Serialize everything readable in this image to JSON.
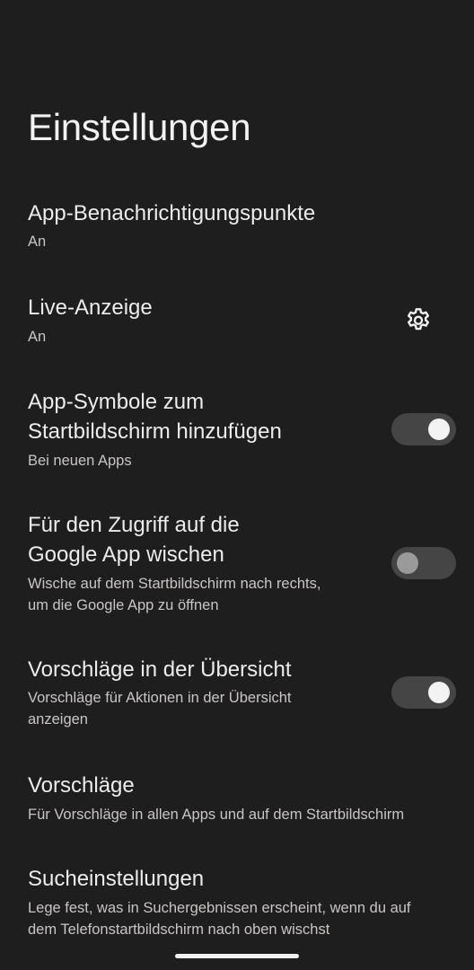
{
  "header": {
    "title": "Einstellungen"
  },
  "settings": [
    {
      "title": "App-Benachrichtigungspunkte",
      "subtitle": "An"
    },
    {
      "title": "Live-Anzeige",
      "subtitle": "An",
      "icon": "gear-icon"
    },
    {
      "title_line1": "App-Symbole zum",
      "title_line2": "Startbildschirm hinzufügen",
      "subtitle": "Bei neuen Apps",
      "toggle_on": true
    },
    {
      "title_line1": "Für den Zugriff auf die",
      "title_line2": "Google App wischen",
      "subtitle_line1": "Wische auf dem Startbildschirm nach rechts,",
      "subtitle_line2": "um die Google App zu öffnen",
      "toggle_on": false
    },
    {
      "title": "Vorschläge in der Übersicht",
      "subtitle_line1": "Vorschläge für Aktionen in der Übersicht",
      "subtitle_line2": "anzeigen",
      "toggle_on": true
    },
    {
      "title": "Vorschläge",
      "subtitle": "Für Vorschläge in allen Apps und auf dem Startbildschirm"
    },
    {
      "title": "Sucheinstellungen",
      "subtitle_line1": "Lege fest, was in Suchergebnissen erscheint, wenn du auf",
      "subtitle_line2": "dem Telefonstartbildschirm nach oben wischst"
    }
  ],
  "colors": {
    "background": "#1e1e1e",
    "text_primary": "#ececec",
    "text_secondary": "#c9c5c5",
    "toggle_track": "#454545",
    "toggle_knob_on": "#f3f3f3",
    "toggle_knob_off": "#9a9a9a"
  }
}
